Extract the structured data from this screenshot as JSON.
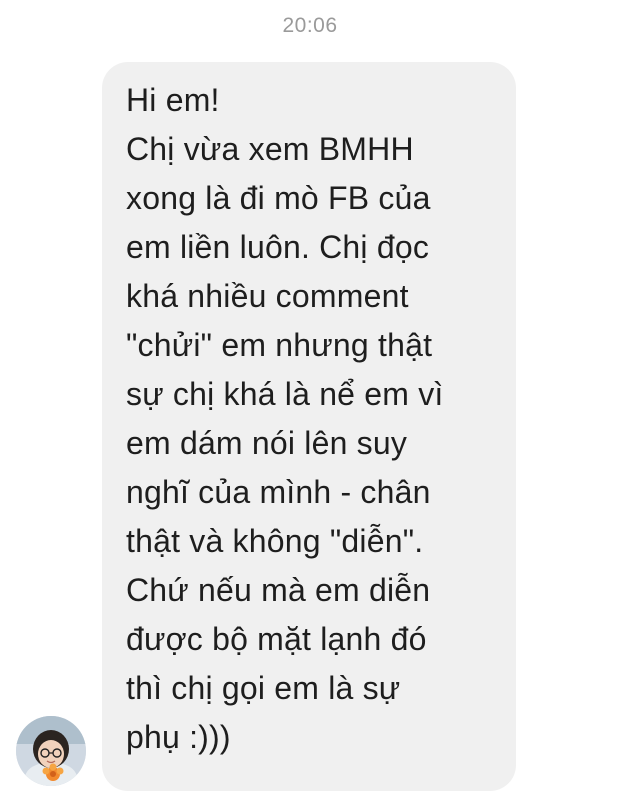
{
  "chat": {
    "timestamp": "20:06",
    "message": {
      "lines": [
        "Hi em!",
        "Chị vừa xem BMHH",
        "xong là đi mò FB của",
        "em liền luôn. Chị đọc",
        "khá nhiều comment",
        "\"chửi\" em nhưng thật",
        "sự chị khá là nể em vì",
        "em dám nói lên suy",
        "nghĩ của mình - chân",
        "thật và không \"diễn\".",
        "Chứ nếu mà em diễn",
        "được bộ mặt lạnh đó",
        "thì chị gọi em là sự",
        "phụ :)))"
      ]
    },
    "sender": {
      "avatar_icon": "user-avatar"
    }
  },
  "colors": {
    "background": "#ffffff",
    "bubble": "#f0f0f0",
    "text": "#1e1e1e",
    "timestamp": "#9a9a9a"
  }
}
